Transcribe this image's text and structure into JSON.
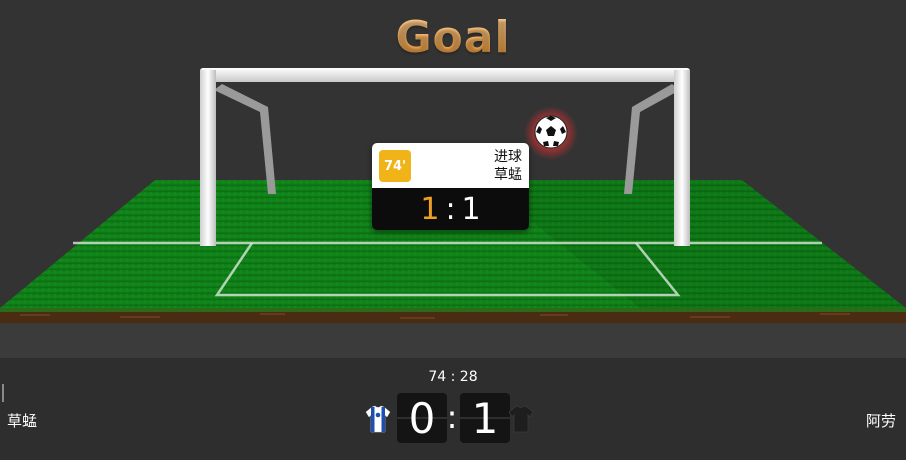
{
  "header": {
    "title": "Goal"
  },
  "event_popup": {
    "minute": "74'",
    "event_type": "进球",
    "team": "草蜢",
    "score_home": "1",
    "separator": ":",
    "score_away": "1"
  },
  "match": {
    "clock": "74 : 28",
    "home_team": "草蜢",
    "away_team": "阿劳",
    "home_score": "0",
    "separator": ":",
    "away_score": "1"
  },
  "colors": {
    "accent": "#f0b318",
    "grass_light": "#1a9a22",
    "grass_dark": "#0a6a10",
    "popup_dark": "#0c0c0c"
  },
  "icons": [
    "soccer-ball-icon",
    "home-jersey-icon",
    "away-jersey-icon"
  ]
}
